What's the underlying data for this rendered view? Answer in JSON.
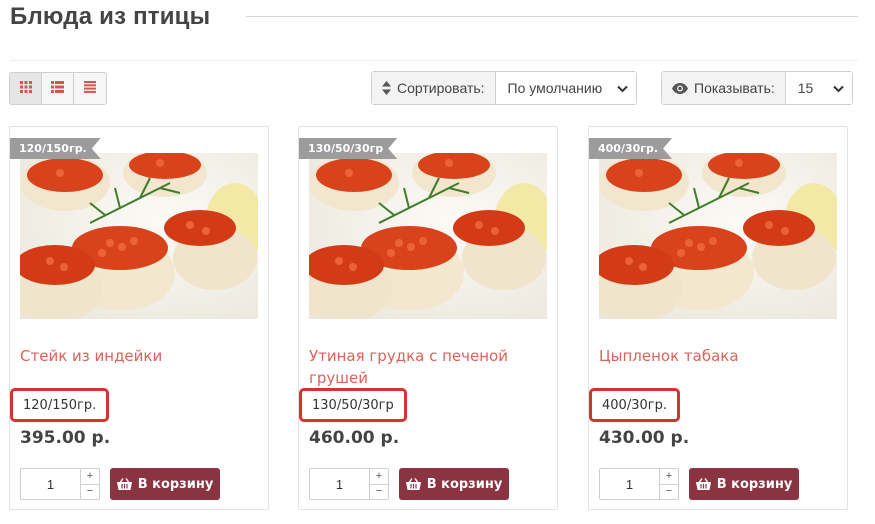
{
  "page": {
    "title": "Блюда из птицы"
  },
  "toolbar": {
    "view_modes": [
      "grid",
      "list",
      "compact"
    ],
    "sort_label": "Сортировать:",
    "sort_value": "По умолчанию",
    "show_label": "Показывать:",
    "show_value": "15"
  },
  "products": [
    {
      "ribbon": "120/150гр.",
      "name": "Стейк из индейки",
      "weight": "120/150гр.",
      "price": "395.00 р.",
      "qty": "1",
      "cart_label": "В корзину"
    },
    {
      "ribbon": "130/50/30гр",
      "name": "Утиная грудка с печеной грушей",
      "weight": "130/50/30гр",
      "price": "460.00 р.",
      "qty": "1",
      "cart_label": "В корзину"
    },
    {
      "ribbon": "400/30гр.",
      "name": "Цыпленок табака",
      "weight": "400/30гр.",
      "price": "430.00 р.",
      "qty": "1",
      "cart_label": "В корзину"
    }
  ],
  "qty_controls": {
    "plus": "+",
    "minus": "−"
  },
  "colors": {
    "accent_name": "#d9635b",
    "cart_button": "#8b3441",
    "highlight_border": "#d8322c",
    "ribbon": "#9c9c9c"
  },
  "icons": {
    "grid": "grid-icon",
    "list": "list-icon",
    "compact": "compact-list-icon",
    "sort": "sort-icon",
    "eye": "eye-icon",
    "basket": "basket-icon",
    "chevron": "chevron-down-icon"
  }
}
